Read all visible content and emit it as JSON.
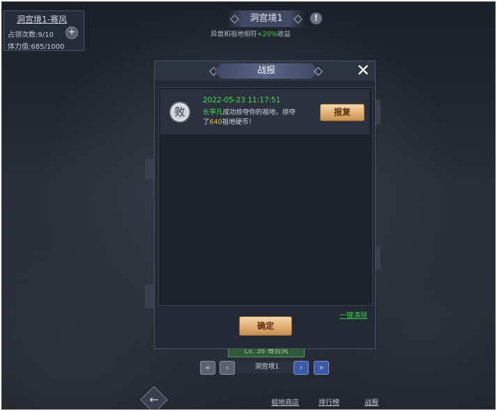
{
  "info_panel": {
    "title": "洞宫境1-骞风",
    "occupy_count": "占领次数:9/10",
    "stamina": "体力值:685/1000",
    "plus_icon": "plus-icon"
  },
  "top": {
    "title": "洞宫境1",
    "alert_glyph": "!",
    "subtitle_prefix": "异兽和祖地相符",
    "subtitle_bonus": "+20%",
    "subtitle_suffix": "收益"
  },
  "modal": {
    "title": "战报",
    "close_glyph": "✕",
    "reports": [
      {
        "result": "败",
        "time": "2022-05-23 11:17:51",
        "attacker": "长亭凡",
        "text_mid": "成功掠夺你的祖地，掠夺了",
        "amount": "640",
        "text_end": "祖地硬币！",
        "revenge_label": "报复"
      }
    ],
    "clear_all": "一键清除",
    "confirm": "确定"
  },
  "level_badge": "Lv. 38  骞否风",
  "pager": {
    "first": "«",
    "prev": "‹",
    "label": "洞宫境1",
    "next": "›",
    "last": "»"
  },
  "bottom_bar": {
    "back_glyph": "←",
    "shop": "祖地商店",
    "ranking": "排行榜",
    "battle_report": "战报"
  },
  "colors": {
    "accent_green": "#3ee04d",
    "amount_gold": "#f2b731",
    "button_gold": "#e2b275"
  }
}
